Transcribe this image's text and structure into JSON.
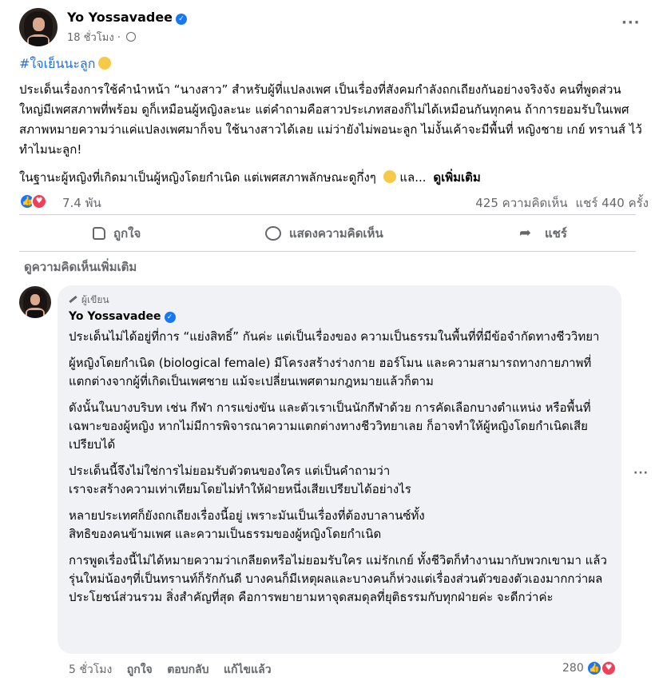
{
  "post": {
    "author": "Yo Yossavadee",
    "time": "18 ชั่วโมง",
    "more": "···",
    "hashtag": "#ใจเย็นนะลูก",
    "paragraphs": [
      "ประเด็นเรื่องการใช้คำนำหน้า “นางสาว” สำหรับผู้ที่แปลงเพศ เป็นเรื่องที่สังคมกำลังถกเถียงกันอย่างจริงจัง คนที่พูดส่วนใหญ่มีเพศสภาพที่พร้อม ดูก็เหมือนผู้หญิงละนะ แต่คำถามคือสาวประเภทสองก็ไม่ได้เหมือนกันทุกคน ถ้าการยอมรับในเพศสภาพหมายความว่าแค่แปลงเพศมาก็จบ ใช้นางสาวได้เลย แม่ว่ายังไม่พอนะลูก ไม่งั้นเค้าจะมีพื้นที่ หญิงชาย เกย์ ทรานส์ ไว้ทำไมนะลูก!"
    ],
    "last_line": "ในฐานะผู้หญิงที่เกิดมาเป็นผู้หญิงโดยกำเนิด แต่เพศสภาพลักษณะดูกึ่งๆ",
    "last_line_tail": "แล...",
    "see_more": "ดูเพิ่มเติม",
    "reaction_count": "7.4 พัน",
    "comments_count": "425 ความคิดเห็น",
    "shares_count": "แชร์ 440 ครั้ง",
    "actions": {
      "like": "ถูกใจ",
      "comment": "แสดงความคิดเห็น",
      "share": "แชร์"
    }
  },
  "view_more_comments": "ดูความคิดเห็นเพิ่มเติม",
  "comment": {
    "badge": "ผู้เขียน",
    "author": "Yo Yossavadee",
    "paragraphs": [
      "ประเด็นไม่ได้อยู่ที่การ “แย่งสิทธิ์” กันค่ะ แต่เป็นเรื่องของ ความเป็นธรรมในพื้นที่ที่มีข้อจำกัดทางชีววิทยา",
      "ผู้หญิงโดยกำเนิด (biological female) มีโครงสร้างร่างกาย ฮอร์โมน และความสามารถทางกายภาพที่แตกต่างจากผู้ที่เกิดเป็นเพศชาย แม้จะเปลี่ยนเพศตามกฎหมายแล้วก็ตาม",
      "ดังนั้นในบางบริบท เช่น กีฬา การแข่งขัน และตัวเราเป็นนักกีฬาด้วย การคัดเลือกบางตำแหน่ง หรือพื้นที่เฉพาะของผู้หญิง หากไม่มีการพิจารณาความแตกต่างทางชีววิทยาเลย ก็อาจทำให้ผู้หญิงโดยกำเนิดเสียเปรียบได้",
      "ประเด็นนี้จึงไม่ใช่การไม่ยอมรับตัวตนของใคร แต่เป็นคำถามว่า\nเราจะสร้างความเท่าเทียมโดยไม่ทำให้ฝ่ายหนึ่งเสียเปรียบได้อย่างไร",
      "หลายประเทศก็ยังถกเถียงเรื่องนี้อยู่ เพราะมันเป็นเรื่องที่ต้องบาลานซ์ทั้ง\nสิทธิของคนข้ามเพศ และความเป็นธรรมของผู้หญิงโดยกำเนิด",
      "การพูดเรื่องนี้ไม่ได้หมายความว่าเกลียดหรือไม่ยอมรับใคร แม่รักเกย์ ทั้งชีวิตก็ทำงานมากับพวกเขามา แล้วรุ่นใหม่น้องๆที่เป็นทรานท์ก็รักกันดี บางคนก็มีเหตุผลและบางคนก็ห่วงแต่เรื่องส่วนตัวของตัวเองมากกว่าผลประโยชน์ส่วนรวม สิ่งสำคัญที่สุด คือการพยายามหาจุดสมดุลที่ยุติธรรมกับทุกฝ่ายค่ะ จะดีกว่าค่ะ"
    ],
    "time": "5 ชั่วโมง",
    "like": "ถูกใจ",
    "reply": "ตอบกลับ",
    "edited": "แก้ไขแล้ว",
    "reaction_count": "280",
    "more": "···"
  },
  "colors": {
    "like_blue": "#1877f2",
    "love_red": "#f33e58",
    "hashtag_blue": "#216fdb",
    "bubble_bg": "#f0f2f5",
    "muted_text": "#65676b"
  },
  "icons": [
    "verified-badge-icon",
    "globe-icon",
    "more-options-icon",
    "like-reaction-icon",
    "love-reaction-icon",
    "thumbs-up-icon",
    "comment-icon",
    "share-arrow-icon",
    "pencil-icon"
  ]
}
